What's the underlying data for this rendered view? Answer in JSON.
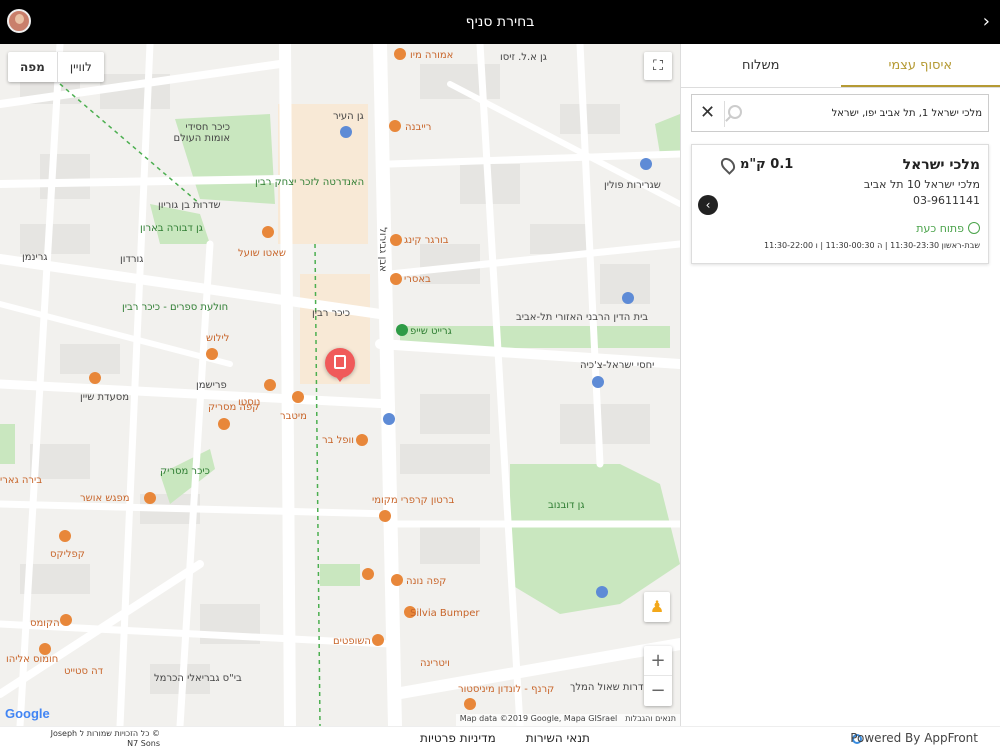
{
  "header": {
    "title": "בחירת סניף",
    "back_glyph": "›"
  },
  "tabs": [
    {
      "label": "איסוף עצמי",
      "active": true
    },
    {
      "label": "משלוח",
      "active": false
    }
  ],
  "search": {
    "value": "מלכי ישראל 1, תל אביב יפו, ישראל"
  },
  "branch": {
    "name": "מלכי ישראל",
    "distance": "0.1 ק\"מ",
    "address": "מלכי ישראל 10 תל אביב",
    "phone": "03-9611141",
    "status": "פתוח כעת",
    "hours": "שבת-ראשון 11:30-23:30 | ה 11:30-00:30 | ו 11:30-22:00"
  },
  "map": {
    "type_options": [
      "לוויין",
      "מפה"
    ],
    "selected_type": "מפה",
    "logo": "Google",
    "data_text": "Map data ©2019 Google, Mapa GISrael",
    "terms_text": "תנאים והגבלות",
    "labels": [
      {
        "text": "גן א.ל. זיסו",
        "cls": ""
      },
      {
        "text": "אמורה מיו",
        "cls": "o"
      },
      {
        "text": "גן העיר",
        "cls": ""
      },
      {
        "text": "רייבנה",
        "cls": "o"
      },
      {
        "text": "כיכר חסידי אומות העולם",
        "cls": ""
      },
      {
        "text": "האנדרטה לזכר יצחק רבין",
        "cls": "g"
      },
      {
        "text": "שגרירות פולין",
        "cls": ""
      },
      {
        "text": "גן דבורה בארון",
        "cls": "g"
      },
      {
        "text": "שאטו שועל",
        "cls": "o"
      },
      {
        "text": "בורגר קינג",
        "cls": "o"
      },
      {
        "text": "באסרי",
        "cls": "o"
      },
      {
        "text": "בית הדין הרבני האזורי תל-אביב",
        "cls": ""
      },
      {
        "text": "חולעת ספרים - כיכר רבין",
        "cls": "g"
      },
      {
        "text": "כיכר רבין",
        "cls": ""
      },
      {
        "text": "גרייט שייפ",
        "cls": "g"
      },
      {
        "text": "לילוש",
        "cls": "o"
      },
      {
        "text": "יחסי ישראל-צ'כיה",
        "cls": ""
      },
      {
        "text": "מסעדת שיין",
        "cls": ""
      },
      {
        "text": "נוסטו",
        "cls": "o"
      },
      {
        "text": "קפה מסריק",
        "cls": "o"
      },
      {
        "text": "מיטבר",
        "cls": "o"
      },
      {
        "text": "וופל בר",
        "cls": "o"
      },
      {
        "text": "כיכר מסריק",
        "cls": "g"
      },
      {
        "text": "בירה גארי",
        "cls": "o"
      },
      {
        "text": "מפגש אושר",
        "cls": "o"
      },
      {
        "text": "ברטון קרפרי מקומי",
        "cls": "o"
      },
      {
        "text": "גן דובנוב",
        "cls": "g"
      },
      {
        "text": "קפליקס",
        "cls": "o"
      },
      {
        "text": "קפה נונה",
        "cls": "o"
      },
      {
        "text": "Silvia Bumper",
        "cls": "o"
      },
      {
        "text": "הקומס",
        "cls": "o"
      },
      {
        "text": "השופטים",
        "cls": "o"
      },
      {
        "text": "ויטרינה",
        "cls": "o"
      },
      {
        "text": "חומוס אליהו",
        "cls": "o"
      },
      {
        "text": "דה סטייט",
        "cls": "o"
      },
      {
        "text": "בי\"ס גבריאלי הכרמל",
        "cls": ""
      },
      {
        "text": "קרנף - לונדון מיניסטור",
        "cls": "o"
      },
      {
        "text": "שדרות שאול המלך",
        "cls": ""
      },
      {
        "text": "פרישמן",
        "cls": ""
      },
      {
        "text": "גורדון",
        "cls": ""
      },
      {
        "text": "אבן גבירול",
        "cls": ""
      },
      {
        "text": "שדרות בן גוריון",
        "cls": ""
      },
      {
        "text": "גרינמן",
        "cls": ""
      }
    ]
  },
  "footer": {
    "copyright": "© כל הזכויות שמורות ל Joseph N7 Sons",
    "privacy": "מדיניות פרטיות",
    "terms": "תנאי השירות",
    "powered": "Powered By AppFront"
  }
}
